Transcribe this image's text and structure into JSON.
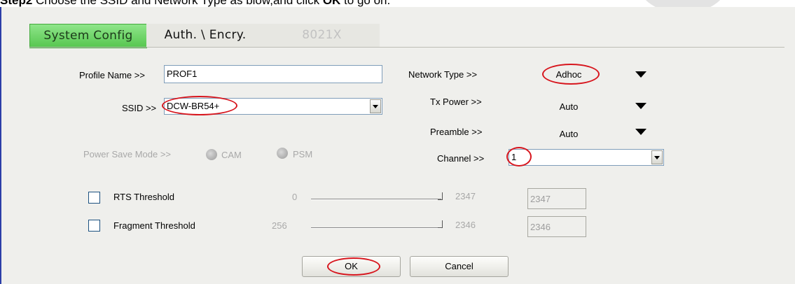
{
  "instruction": {
    "step": "Step2",
    "text_before": " Choose the SSID and Network Type as blow,and click ",
    "ok_word": "OK",
    "text_after": " to go on."
  },
  "tabs": [
    {
      "label": "System Config",
      "active": true
    },
    {
      "label": "Auth. \\ Encry.",
      "active": false
    },
    {
      "label": "8021X",
      "disabled": true
    }
  ],
  "profile": {
    "label": "Profile Name >>",
    "value": "PROF1"
  },
  "ssid": {
    "label": "SSID >>",
    "value": "DCW-BR54+"
  },
  "power_save": {
    "label": "Power Save Mode >>",
    "options": [
      "CAM",
      "PSM"
    ]
  },
  "network_type": {
    "label": "Network Type >>",
    "value": "Adhoc"
  },
  "tx_power": {
    "label": "Tx Power >>",
    "value": "Auto"
  },
  "preamble": {
    "label": "Preamble >>",
    "value": "Auto"
  },
  "channel": {
    "label": "Channel >>",
    "value": "1"
  },
  "rts": {
    "label": "RTS Threshold",
    "min": "0",
    "max": "2347",
    "value": "2347"
  },
  "fragment": {
    "label": "Fragment Threshold",
    "min": "256",
    "max": "2346",
    "value": "2346"
  },
  "buttons": {
    "ok": "OK",
    "cancel": "Cancel"
  },
  "colors": {
    "active_tab": "#56c64f",
    "highlight_ellipse": "#d7151d",
    "frame_border": "#2c3ea8"
  }
}
